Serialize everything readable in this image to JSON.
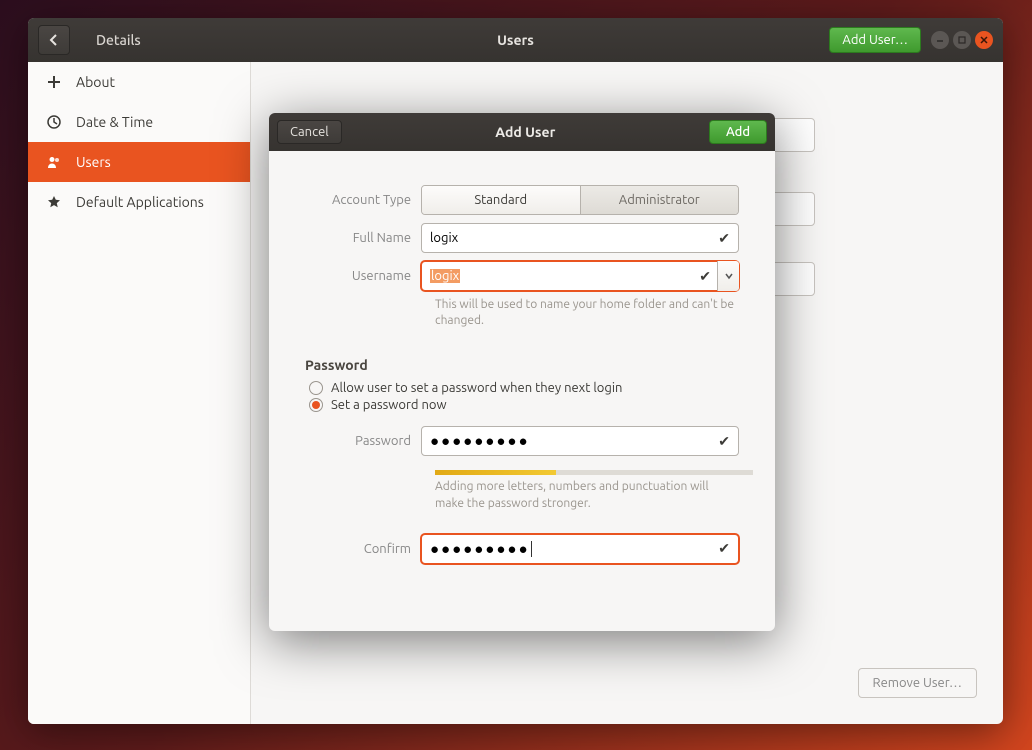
{
  "titlebar": {
    "breadcrumb": "Details",
    "title": "Users",
    "add_user_btn": "Add User…"
  },
  "sidebar": {
    "items": [
      {
        "label": "About"
      },
      {
        "label": "Date & Time"
      },
      {
        "label": "Users"
      },
      {
        "label": "Default Applications"
      }
    ],
    "active_index": 2
  },
  "main": {
    "remove_user_btn": "Remove User…"
  },
  "dialog": {
    "cancel": "Cancel",
    "title": "Add User",
    "add": "Add",
    "account_type_label": "Account Type",
    "account_type_standard": "Standard",
    "account_type_admin": "Administrator",
    "full_name_label": "Full Name",
    "full_name_value": "logix",
    "username_label": "Username",
    "username_value": "logix",
    "username_hint": "This will be used to name your home folder and can't be changed.",
    "password_section": "Password",
    "radio_later": "Allow user to set a password when they next login",
    "radio_now": "Set a password now",
    "password_label": "Password",
    "password_value": "●●●●●●●●●",
    "password_hint": "Adding more letters, numbers and punctuation will make the password stronger.",
    "password_strength_pct": 38,
    "confirm_label": "Confirm",
    "confirm_value": "●●●●●●●●●"
  }
}
